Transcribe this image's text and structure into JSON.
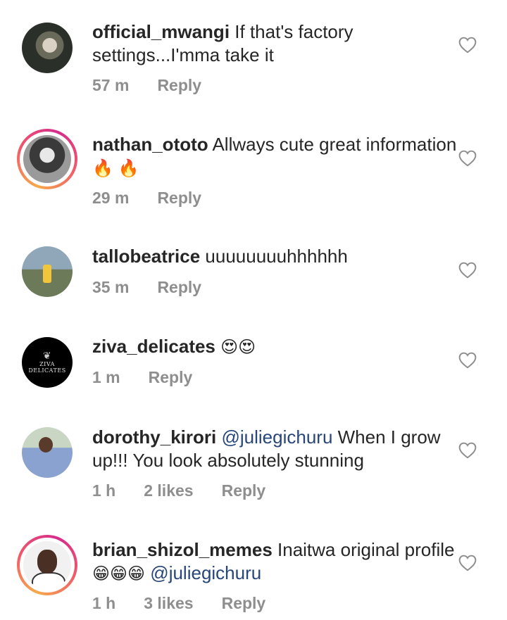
{
  "comments": [
    {
      "username": "official_mwangi",
      "parts": [
        {
          "text": "If that's factory settings...I'mma take it"
        }
      ],
      "time": "57 m",
      "likes": "",
      "reply": "Reply",
      "story_ring": false
    },
    {
      "username": "nathan_ototo",
      "parts": [
        {
          "text": "Allways cute great information "
        },
        {
          "emoji": "🔥 🔥"
        }
      ],
      "time": "29 m",
      "likes": "",
      "reply": "Reply",
      "story_ring": true
    },
    {
      "username": "tallobeatrice",
      "parts": [
        {
          "text": "uuuuuuuuhhhhhh"
        }
      ],
      "time": "35 m",
      "likes": "",
      "reply": "Reply",
      "story_ring": false
    },
    {
      "username": "ziva_delicates",
      "parts": [
        {
          "emoji": "😍😍"
        }
      ],
      "time": "1 m",
      "likes": "",
      "reply": "Reply",
      "story_ring": false,
      "avatar_text": "ZIVA DELICATES"
    },
    {
      "username": "dorothy_kirori",
      "parts": [
        {
          "mention": "@juliegichuru"
        },
        {
          "text": " When I grow up!!! You look absolutely stunning"
        }
      ],
      "time": "1 h",
      "likes": "2 likes",
      "reply": "Reply",
      "story_ring": false
    },
    {
      "username": "brian_shizol_memes",
      "parts": [
        {
          "text": "Inaitwa original profile"
        },
        {
          "emoji": "😁😁😁"
        },
        {
          "text": " "
        },
        {
          "mention": "@juliegichuru"
        }
      ],
      "time": "1 h",
      "likes": "3 likes",
      "reply": "Reply",
      "story_ring": true
    }
  ],
  "icons": {
    "like": "heart-outline-icon"
  },
  "colors": {
    "text": "#262626",
    "meta": "#8e8e8e",
    "mention": "#27467a"
  }
}
